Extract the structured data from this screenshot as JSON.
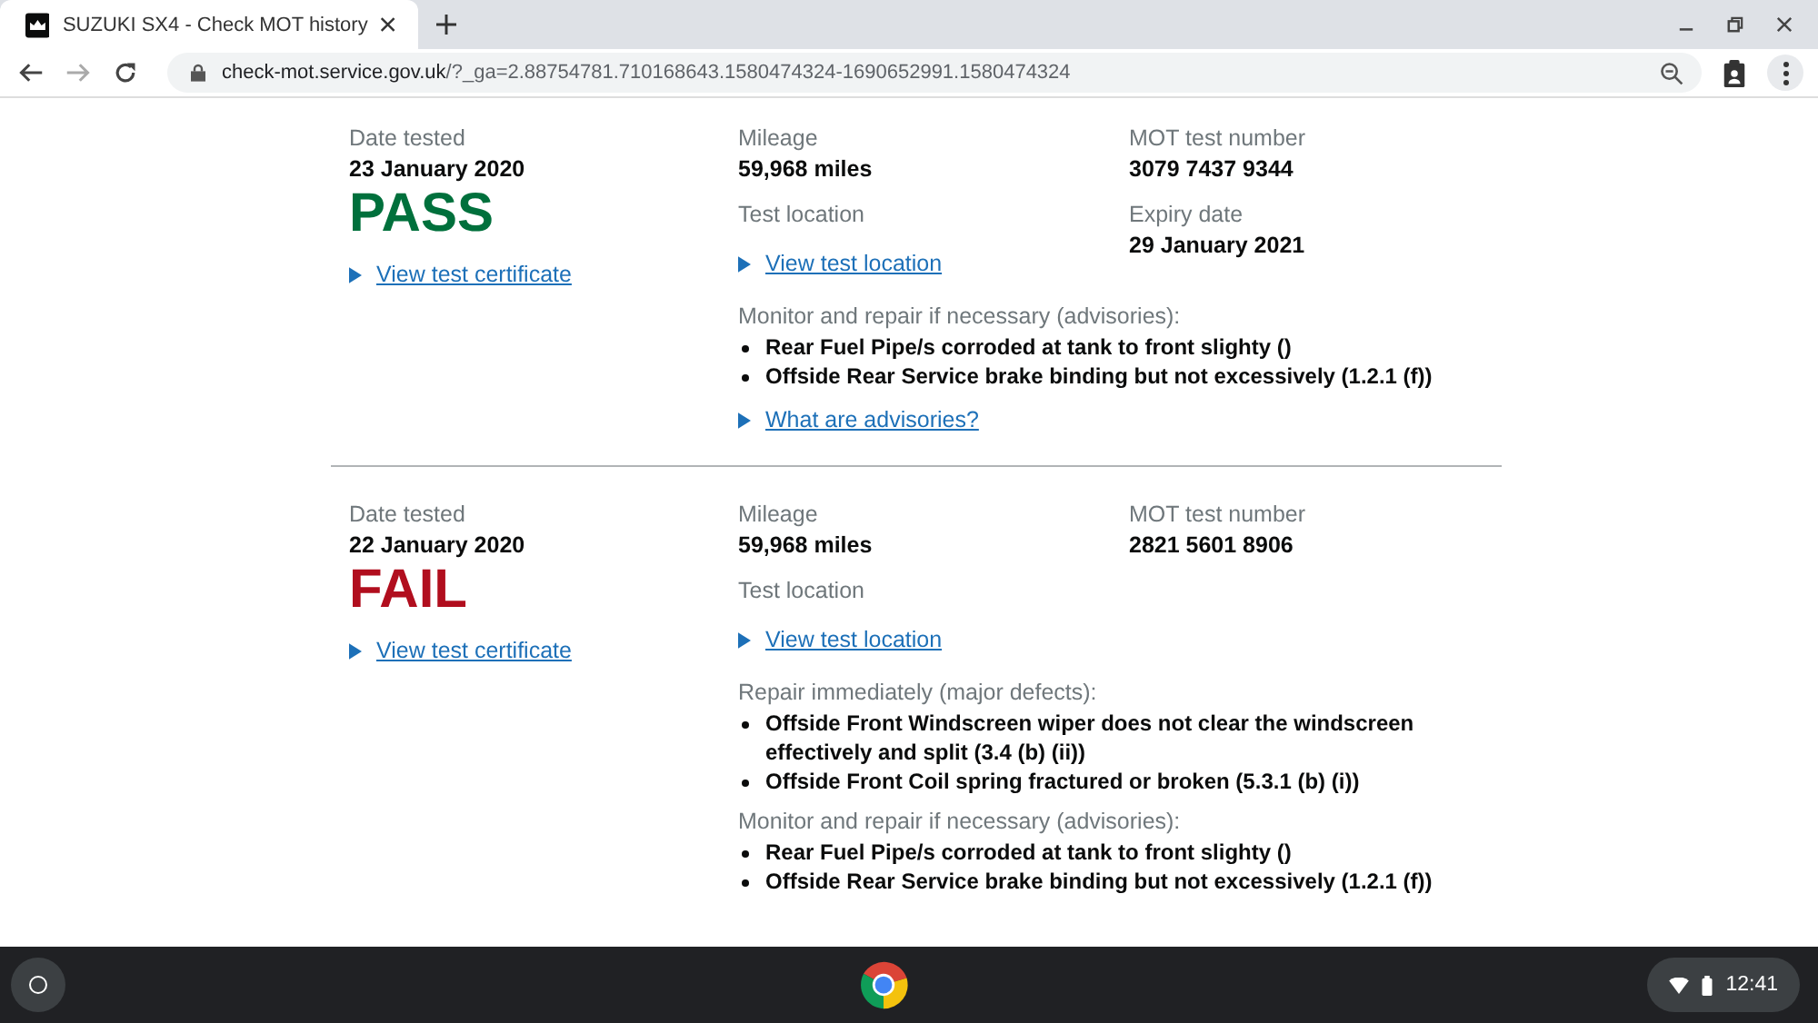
{
  "browser": {
    "tab": {
      "title": "SUZUKI SX4 - Check MOT history",
      "selected": true
    },
    "url_host": "check-mot.service.gov.uk",
    "url_path": "/?_ga=2.88754781.710168643.1580474324-1690652991.1580474324"
  },
  "tests": [
    {
      "date_label": "Date tested",
      "date": "23 January 2020",
      "result": {
        "kind": "pass",
        "text": "PASS"
      },
      "certificate_link": "View test certificate",
      "mileage_label": "Mileage",
      "mileage": "59,968 miles",
      "location_label": "Test location",
      "location_link": "View test location",
      "number_label": "MOT test number",
      "number": "3079 7437 9344",
      "expiry_label": "Expiry date",
      "expiry": "29 January 2021",
      "defect_groups": [
        {
          "heading": "Monitor and repair if necessary (advisories):",
          "items": [
            "Rear Fuel Pipe/s corroded at tank to front slighty ()",
            "Offside Rear Service brake binding but not excessively (1.2.1 (f))"
          ]
        }
      ],
      "help_link": "What are advisories?"
    },
    {
      "date_label": "Date tested",
      "date": "22 January 2020",
      "result": {
        "kind": "fail",
        "text": "FAIL"
      },
      "certificate_link": "View test certificate",
      "mileage_label": "Mileage",
      "mileage": "59,968 miles",
      "location_label": "Test location",
      "location_link": "View test location",
      "number_label": "MOT test number",
      "number": "2821 5601 8906",
      "defect_groups": [
        {
          "heading": "Repair immediately (major defects):",
          "items": [
            "Offside Front Windscreen wiper does not clear the windscreen effectively and split (3.4 (b) (ii))",
            "Offside Front Coil spring fractured or broken (5.3.1 (b) (i))"
          ]
        },
        {
          "heading": "Monitor and repair if necessary (advisories):",
          "items": [
            "Rear Fuel Pipe/s corroded at tank to front slighty ()",
            "Offside Rear Service brake binding but not excessively (1.2.1 (f))"
          ]
        }
      ]
    }
  ],
  "shelf": {
    "time": "12:41"
  }
}
